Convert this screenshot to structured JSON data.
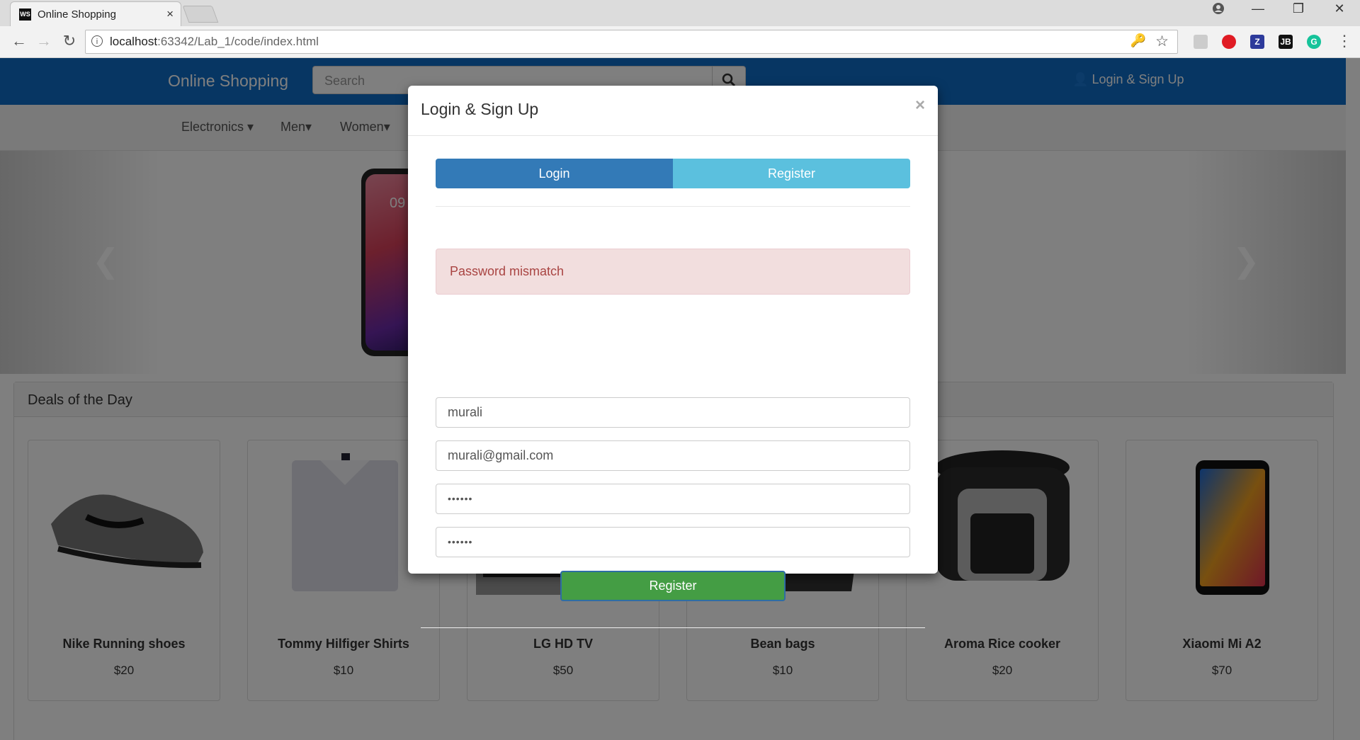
{
  "browser": {
    "tab_title": "Online Shopping",
    "tab_close": "×",
    "url_host": "localhost",
    "url_path": ":63342/Lab_1/code/index.html",
    "favicon_text": "WS"
  },
  "navbar": {
    "brand": "Online Shopping",
    "search_placeholder": "Search",
    "login_label": "Login & Sign Up",
    "accent_color": "#0f6cc6"
  },
  "categories": [
    "Electronics",
    "Men",
    "Women"
  ],
  "carousel": {
    "prev_icon": "chevron-left-icon",
    "next_icon": "chevron-right-icon",
    "phone_time": "09"
  },
  "deals": {
    "title": "Deals of the Day",
    "products": [
      {
        "name": "Nike Running shoes",
        "price": "$20"
      },
      {
        "name": "Tommy Hilfiger Shirts",
        "price": "$10"
      },
      {
        "name": "LG HD TV",
        "price": "$50"
      },
      {
        "name": "Bean bags",
        "price": "$10"
      },
      {
        "name": "Aroma Rice cooker",
        "price": "$20"
      },
      {
        "name": "Xiaomi Mi A2",
        "price": "$70"
      }
    ]
  },
  "modal": {
    "title": "Login & Sign Up",
    "close": "×",
    "tab_login": "Login",
    "tab_register": "Register",
    "alert": "Password mismatch",
    "username": "murali",
    "email": "murali@gmail.com",
    "password": "••••••",
    "confirm_password": "••••••",
    "submit": "Register",
    "colors": {
      "login_tab": "#337ab7",
      "register_tab": "#5bc0de",
      "submit": "#449d44",
      "alert_bg": "#f2dede",
      "alert_text": "#a94442"
    }
  }
}
